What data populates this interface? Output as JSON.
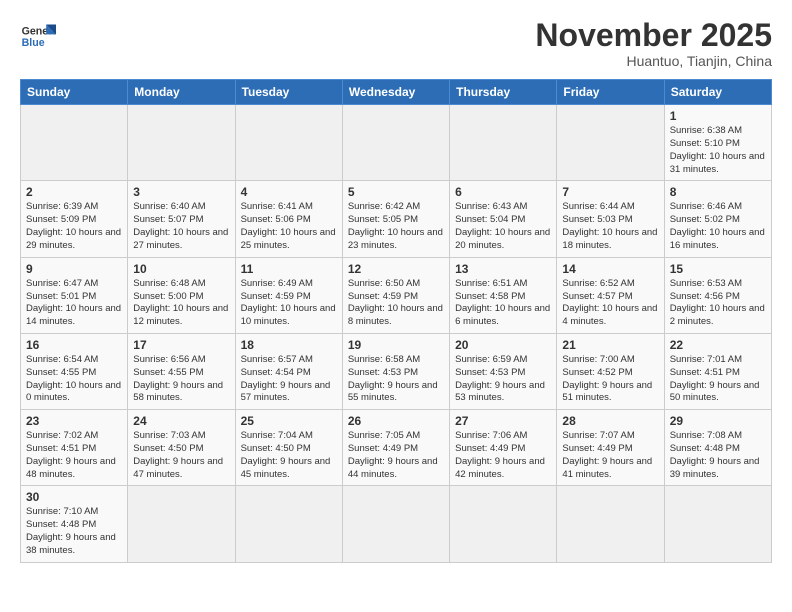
{
  "logo": {
    "line1": "General",
    "line2": "Blue"
  },
  "title": "November 2025",
  "subtitle": "Huantuo, Tianjin, China",
  "weekdays": [
    "Sunday",
    "Monday",
    "Tuesday",
    "Wednesday",
    "Thursday",
    "Friday",
    "Saturday"
  ],
  "weeks": [
    [
      {
        "day": "",
        "info": ""
      },
      {
        "day": "",
        "info": ""
      },
      {
        "day": "",
        "info": ""
      },
      {
        "day": "",
        "info": ""
      },
      {
        "day": "",
        "info": ""
      },
      {
        "day": "",
        "info": ""
      },
      {
        "day": "1",
        "info": "Sunrise: 6:38 AM\nSunset: 5:10 PM\nDaylight: 10 hours and 31 minutes."
      }
    ],
    [
      {
        "day": "2",
        "info": "Sunrise: 6:39 AM\nSunset: 5:09 PM\nDaylight: 10 hours and 29 minutes."
      },
      {
        "day": "3",
        "info": "Sunrise: 6:40 AM\nSunset: 5:07 PM\nDaylight: 10 hours and 27 minutes."
      },
      {
        "day": "4",
        "info": "Sunrise: 6:41 AM\nSunset: 5:06 PM\nDaylight: 10 hours and 25 minutes."
      },
      {
        "day": "5",
        "info": "Sunrise: 6:42 AM\nSunset: 5:05 PM\nDaylight: 10 hours and 23 minutes."
      },
      {
        "day": "6",
        "info": "Sunrise: 6:43 AM\nSunset: 5:04 PM\nDaylight: 10 hours and 20 minutes."
      },
      {
        "day": "7",
        "info": "Sunrise: 6:44 AM\nSunset: 5:03 PM\nDaylight: 10 hours and 18 minutes."
      },
      {
        "day": "8",
        "info": "Sunrise: 6:46 AM\nSunset: 5:02 PM\nDaylight: 10 hours and 16 minutes."
      }
    ],
    [
      {
        "day": "9",
        "info": "Sunrise: 6:47 AM\nSunset: 5:01 PM\nDaylight: 10 hours and 14 minutes."
      },
      {
        "day": "10",
        "info": "Sunrise: 6:48 AM\nSunset: 5:00 PM\nDaylight: 10 hours and 12 minutes."
      },
      {
        "day": "11",
        "info": "Sunrise: 6:49 AM\nSunset: 4:59 PM\nDaylight: 10 hours and 10 minutes."
      },
      {
        "day": "12",
        "info": "Sunrise: 6:50 AM\nSunset: 4:59 PM\nDaylight: 10 hours and 8 minutes."
      },
      {
        "day": "13",
        "info": "Sunrise: 6:51 AM\nSunset: 4:58 PM\nDaylight: 10 hours and 6 minutes."
      },
      {
        "day": "14",
        "info": "Sunrise: 6:52 AM\nSunset: 4:57 PM\nDaylight: 10 hours and 4 minutes."
      },
      {
        "day": "15",
        "info": "Sunrise: 6:53 AM\nSunset: 4:56 PM\nDaylight: 10 hours and 2 minutes."
      }
    ],
    [
      {
        "day": "16",
        "info": "Sunrise: 6:54 AM\nSunset: 4:55 PM\nDaylight: 10 hours and 0 minutes."
      },
      {
        "day": "17",
        "info": "Sunrise: 6:56 AM\nSunset: 4:55 PM\nDaylight: 9 hours and 58 minutes."
      },
      {
        "day": "18",
        "info": "Sunrise: 6:57 AM\nSunset: 4:54 PM\nDaylight: 9 hours and 57 minutes."
      },
      {
        "day": "19",
        "info": "Sunrise: 6:58 AM\nSunset: 4:53 PM\nDaylight: 9 hours and 55 minutes."
      },
      {
        "day": "20",
        "info": "Sunrise: 6:59 AM\nSunset: 4:53 PM\nDaylight: 9 hours and 53 minutes."
      },
      {
        "day": "21",
        "info": "Sunrise: 7:00 AM\nSunset: 4:52 PM\nDaylight: 9 hours and 51 minutes."
      },
      {
        "day": "22",
        "info": "Sunrise: 7:01 AM\nSunset: 4:51 PM\nDaylight: 9 hours and 50 minutes."
      }
    ],
    [
      {
        "day": "23",
        "info": "Sunrise: 7:02 AM\nSunset: 4:51 PM\nDaylight: 9 hours and 48 minutes."
      },
      {
        "day": "24",
        "info": "Sunrise: 7:03 AM\nSunset: 4:50 PM\nDaylight: 9 hours and 47 minutes."
      },
      {
        "day": "25",
        "info": "Sunrise: 7:04 AM\nSunset: 4:50 PM\nDaylight: 9 hours and 45 minutes."
      },
      {
        "day": "26",
        "info": "Sunrise: 7:05 AM\nSunset: 4:49 PM\nDaylight: 9 hours and 44 minutes."
      },
      {
        "day": "27",
        "info": "Sunrise: 7:06 AM\nSunset: 4:49 PM\nDaylight: 9 hours and 42 minutes."
      },
      {
        "day": "28",
        "info": "Sunrise: 7:07 AM\nSunset: 4:49 PM\nDaylight: 9 hours and 41 minutes."
      },
      {
        "day": "29",
        "info": "Sunrise: 7:08 AM\nSunset: 4:48 PM\nDaylight: 9 hours and 39 minutes."
      }
    ],
    [
      {
        "day": "30",
        "info": "Sunrise: 7:10 AM\nSunset: 4:48 PM\nDaylight: 9 hours and 38 minutes."
      },
      {
        "day": "",
        "info": ""
      },
      {
        "day": "",
        "info": ""
      },
      {
        "day": "",
        "info": ""
      },
      {
        "day": "",
        "info": ""
      },
      {
        "day": "",
        "info": ""
      },
      {
        "day": "",
        "info": ""
      }
    ]
  ]
}
